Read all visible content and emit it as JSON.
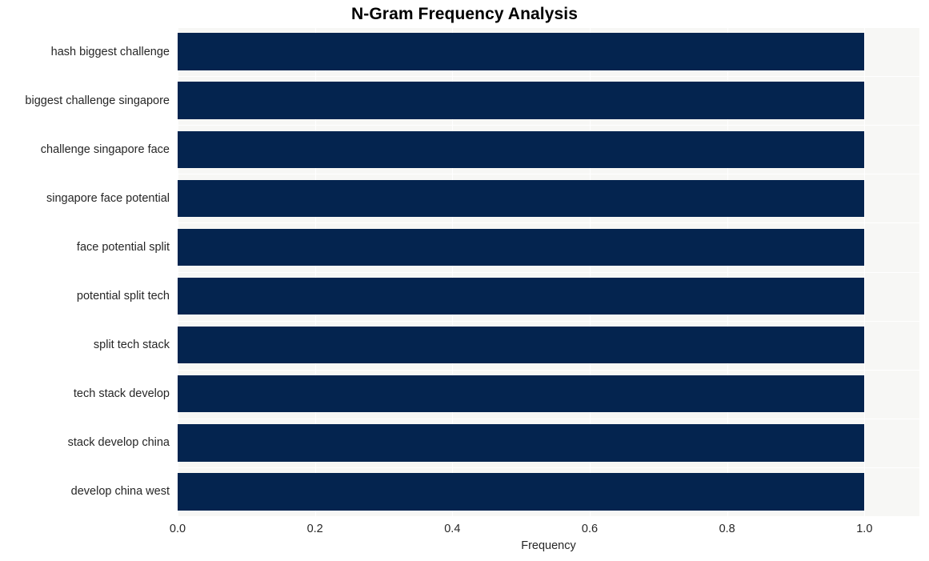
{
  "chart_data": {
    "type": "bar",
    "orientation": "horizontal",
    "title": "N-Gram Frequency Analysis",
    "xlabel": "Frequency",
    "ylabel": "",
    "categories": [
      "hash biggest challenge",
      "biggest challenge singapore",
      "challenge singapore face",
      "singapore face potential",
      "face potential split",
      "potential split tech",
      "split tech stack",
      "tech stack develop",
      "stack develop china",
      "develop china west"
    ],
    "values": [
      1.0,
      1.0,
      1.0,
      1.0,
      1.0,
      1.0,
      1.0,
      1.0,
      1.0,
      1.0
    ],
    "xlim": [
      0.0,
      1.08
    ],
    "xticks": [
      0.0,
      0.2,
      0.4,
      0.6,
      0.8,
      1.0
    ],
    "xtick_labels": [
      "0.0",
      "0.2",
      "0.4",
      "0.6",
      "0.8",
      "1.0"
    ],
    "grid": true,
    "grid_color": "#ffffff",
    "legend": null,
    "bar_color": "#04244f",
    "plot_background": "#f7f7f5",
    "figure_background": "#ffffff"
  }
}
